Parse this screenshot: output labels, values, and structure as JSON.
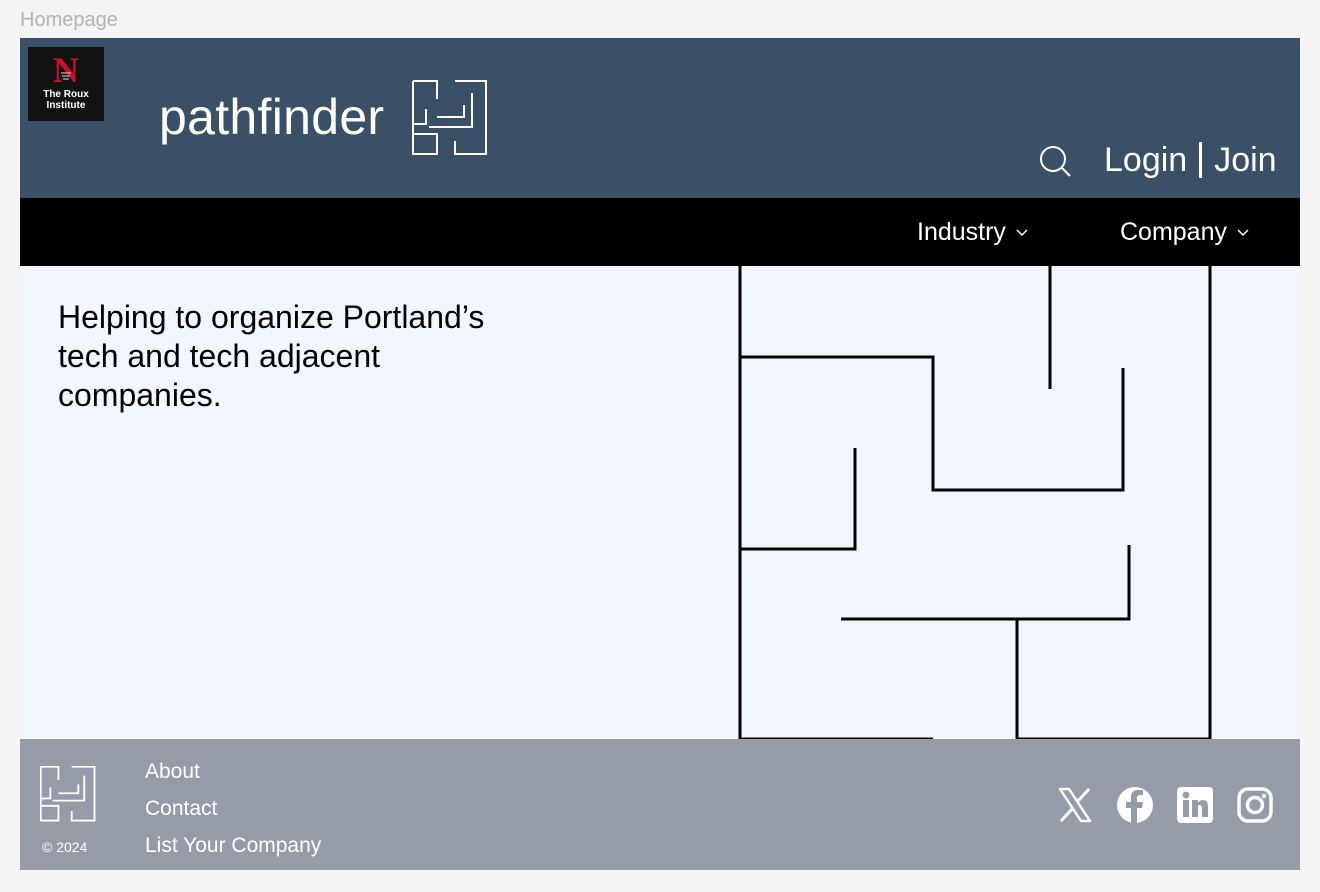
{
  "frame": {
    "label": "Homepage"
  },
  "header": {
    "partner_logo": {
      "letter": "N",
      "line1": "The Roux",
      "line2": "Institute"
    },
    "brand": "pathfinder",
    "login": "Login",
    "join": "Join"
  },
  "nav": {
    "items": [
      {
        "label": "Industry"
      },
      {
        "label": "Company"
      }
    ]
  },
  "hero": {
    "tagline": "Helping to organize Portland’s tech and tech adjacent companies."
  },
  "footer": {
    "copyright": "© 2024",
    "links": [
      "About",
      "Contact",
      "List Your Company"
    ],
    "social": [
      "x-icon",
      "facebook-icon",
      "linkedin-icon",
      "instagram-icon"
    ]
  },
  "colors": {
    "header_bg": "#3a5066",
    "nav_bg": "#000000",
    "hero_bg": "#f2f7fe",
    "footer_bg": "#969ba8",
    "partner_accent": "#c8102e"
  }
}
